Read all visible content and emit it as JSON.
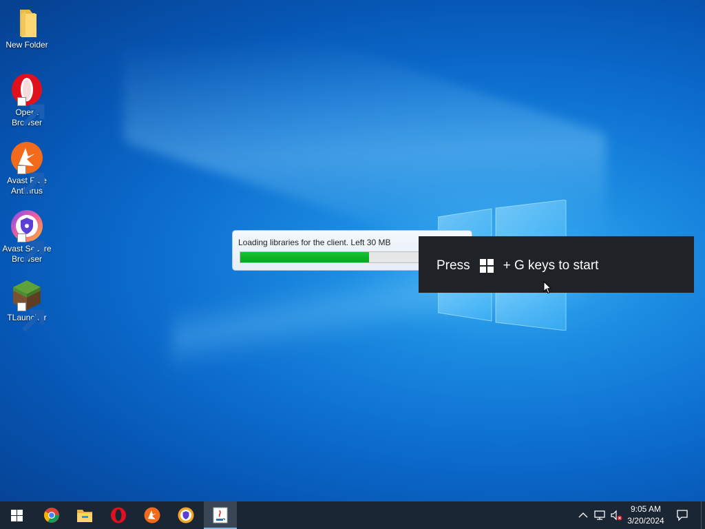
{
  "desktop": {
    "icons": [
      {
        "label": "New Folder",
        "icon": "folder-icon"
      },
      {
        "label": "Opera Browser",
        "icon": "opera-icon"
      },
      {
        "label": "Avast Free Antivirus",
        "icon": "avast-antivirus-icon"
      },
      {
        "label": "Avast Secure Browser",
        "icon": "avast-secure-browser-icon"
      },
      {
        "label": "TLauncher",
        "icon": "minecraft-block-icon"
      }
    ]
  },
  "loader": {
    "message": "Loading libraries for the client. Left 30 MB",
    "progress": 0.57,
    "accent": "#0aa926"
  },
  "toast": {
    "press": "Press",
    "key_icon": "windows-logo-icon",
    "rest": "+ G keys to start"
  },
  "taskbar": {
    "apps": [
      {
        "name": "start",
        "icon": "windows-start-icon"
      },
      {
        "name": "chrome",
        "icon": "chrome-icon"
      },
      {
        "name": "file-explorer",
        "icon": "folder-icon"
      },
      {
        "name": "opera",
        "icon": "opera-icon"
      },
      {
        "name": "avast",
        "icon": "avast-antivirus-icon"
      },
      {
        "name": "avast-secure-browser",
        "icon": "avast-secure-browser-icon"
      },
      {
        "name": "java",
        "icon": "java-icon",
        "active": true
      }
    ],
    "tray": {
      "icons": [
        "chevron-up-icon",
        "network-icon",
        "volume-muted-icon",
        "notification-icon"
      ],
      "time": "9:05 AM",
      "date": "3/20/2024"
    }
  },
  "colors": {
    "taskbar_bg": "#1b2634",
    "toast_bg": "#1f2227",
    "desktop_blue": "#0d6fd0"
  }
}
